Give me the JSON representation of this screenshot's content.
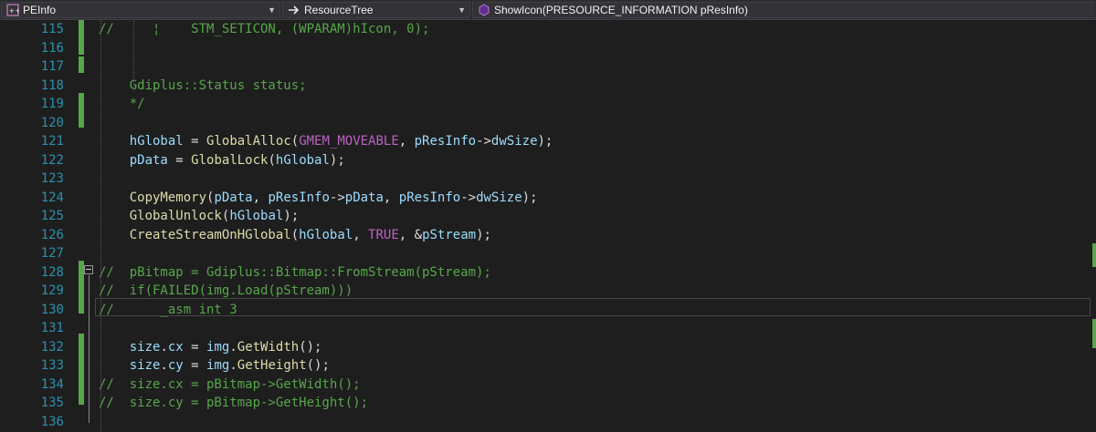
{
  "nav": {
    "project": "PEInfo",
    "scope": "ResourceTree",
    "member": "ShowIcon(PRESOURCE_INFORMATION pResInfo)"
  },
  "lines": [
    {
      "num": "115",
      "tokens": [
        [
          "c-cm",
          "//     ¦    STM_SETICON, (WPARAM)hIcon, 0);"
        ]
      ]
    },
    {
      "num": "116",
      "tokens": []
    },
    {
      "num": "117",
      "tokens": []
    },
    {
      "num": "118",
      "tokens": [
        [
          "c-cm",
          "    Gdiplus::Status status;"
        ]
      ]
    },
    {
      "num": "119",
      "tokens": [
        [
          "c-cm",
          "    */"
        ]
      ]
    },
    {
      "num": "120",
      "tokens": []
    },
    {
      "num": "121",
      "tokens": [
        [
          "c-tx",
          "    "
        ],
        [
          "c-id",
          "hGlobal"
        ],
        [
          "c-tx",
          " = "
        ],
        [
          "c-fn",
          "GlobalAlloc"
        ],
        [
          "c-tx",
          "("
        ],
        [
          "c-mac",
          "GMEM_MOVEABLE"
        ],
        [
          "c-tx",
          ", "
        ],
        [
          "c-id",
          "pResInfo"
        ],
        [
          "c-tx",
          "->"
        ],
        [
          "c-id",
          "dwSize"
        ],
        [
          "c-tx",
          ");"
        ]
      ]
    },
    {
      "num": "122",
      "tokens": [
        [
          "c-tx",
          "    "
        ],
        [
          "c-id",
          "pData"
        ],
        [
          "c-tx",
          " = "
        ],
        [
          "c-fn",
          "GlobalLock"
        ],
        [
          "c-tx",
          "("
        ],
        [
          "c-id",
          "hGlobal"
        ],
        [
          "c-tx",
          ");"
        ]
      ]
    },
    {
      "num": "123",
      "tokens": []
    },
    {
      "num": "124",
      "tokens": [
        [
          "c-tx",
          "    "
        ],
        [
          "c-fn",
          "CopyMemory"
        ],
        [
          "c-tx",
          "("
        ],
        [
          "c-id",
          "pData"
        ],
        [
          "c-tx",
          ", "
        ],
        [
          "c-id",
          "pResInfo"
        ],
        [
          "c-tx",
          "->"
        ],
        [
          "c-id",
          "pData"
        ],
        [
          "c-tx",
          ", "
        ],
        [
          "c-id",
          "pResInfo"
        ],
        [
          "c-tx",
          "->"
        ],
        [
          "c-id",
          "dwSize"
        ],
        [
          "c-tx",
          ");"
        ]
      ]
    },
    {
      "num": "125",
      "tokens": [
        [
          "c-tx",
          "    "
        ],
        [
          "c-fn",
          "GlobalUnlock"
        ],
        [
          "c-tx",
          "("
        ],
        [
          "c-id",
          "hGlobal"
        ],
        [
          "c-tx",
          ");"
        ]
      ]
    },
    {
      "num": "126",
      "tokens": [
        [
          "c-tx",
          "    "
        ],
        [
          "c-fn",
          "CreateStreamOnHGlobal"
        ],
        [
          "c-tx",
          "("
        ],
        [
          "c-id",
          "hGlobal"
        ],
        [
          "c-tx",
          ", "
        ],
        [
          "c-mac",
          "TRUE"
        ],
        [
          "c-tx",
          ", &"
        ],
        [
          "c-id",
          "pStream"
        ],
        [
          "c-tx",
          ");"
        ]
      ]
    },
    {
      "num": "127",
      "tokens": []
    },
    {
      "num": "128",
      "tokens": [
        [
          "c-cm",
          "//  pBitmap = Gdiplus::Bitmap::FromStream(pStream);"
        ]
      ]
    },
    {
      "num": "129",
      "tokens": [
        [
          "c-cm",
          "//  if(FAILED(img.Load(pStream)))"
        ]
      ]
    },
    {
      "num": "130",
      "tokens": [
        [
          "c-cm",
          "//      _asm int 3"
        ]
      ]
    },
    {
      "num": "131",
      "tokens": []
    },
    {
      "num": "132",
      "tokens": [
        [
          "c-tx",
          "    "
        ],
        [
          "c-id",
          "size"
        ],
        [
          "c-tx",
          "."
        ],
        [
          "c-id",
          "cx"
        ],
        [
          "c-tx",
          " = "
        ],
        [
          "c-id",
          "img"
        ],
        [
          "c-tx",
          "."
        ],
        [
          "c-fn",
          "GetWidth"
        ],
        [
          "c-tx",
          "();"
        ]
      ]
    },
    {
      "num": "133",
      "tokens": [
        [
          "c-tx",
          "    "
        ],
        [
          "c-id",
          "size"
        ],
        [
          "c-tx",
          "."
        ],
        [
          "c-id",
          "cy"
        ],
        [
          "c-tx",
          " = "
        ],
        [
          "c-id",
          "img"
        ],
        [
          "c-tx",
          "."
        ],
        [
          "c-fn",
          "GetHeight"
        ],
        [
          "c-tx",
          "();"
        ]
      ]
    },
    {
      "num": "134",
      "tokens": [
        [
          "c-cm",
          "//  size.cx = pBitmap->GetWidth();"
        ]
      ]
    },
    {
      "num": "135",
      "tokens": [
        [
          "c-cm",
          "//  size.cy = pBitmap->GetHeight();"
        ]
      ]
    },
    {
      "num": "136",
      "tokens": []
    }
  ],
  "colors": {
    "comment": "#57a64a",
    "function": "#dcdcaa",
    "identifier": "#9cdcfe",
    "macro": "#bd63c5",
    "line_number": "#2b91af",
    "background": "#1e1e1e"
  }
}
